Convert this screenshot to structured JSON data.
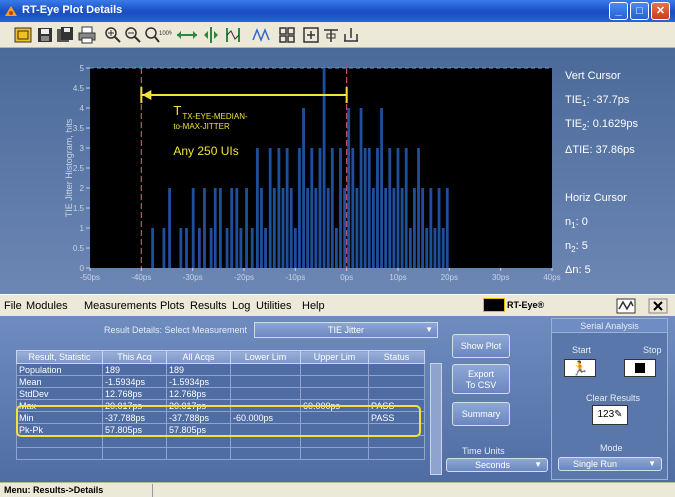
{
  "window": {
    "title": "RT-Eye Plot Details"
  },
  "toolbar": {
    "icons": [
      "zoom-box-icon",
      "save-icon",
      "save-all-icon",
      "print-icon",
      "zoom-in-icon",
      "zoom-out-icon",
      "zoom-100-icon",
      "cursor-horizontal-icon",
      "cursor-vertical-icon",
      "cursor-both-icon",
      "waveform-icon",
      "layout-grid-icon",
      "fit-icon",
      "marker-icon",
      "baseline-icon"
    ]
  },
  "chart_data": {
    "type": "bar",
    "ylabel": "TIE Jitter Histogram, hits",
    "xlim": [
      -50,
      40
    ],
    "ylim": [
      0,
      5
    ],
    "y_ticks": [
      "0",
      "0.5",
      "1",
      "1.5",
      "2",
      "2.5",
      "3",
      "3.5",
      "4",
      "4.5",
      "5"
    ],
    "x_ticks": [
      "-50ps",
      "-40ps",
      "-30ps",
      "-20ps",
      "-10ps",
      "0ps",
      "10ps",
      "20ps",
      "30ps",
      "40ps"
    ],
    "x_tick_values": [
      -50,
      -40,
      -30,
      -20,
      -10,
      0,
      10,
      20,
      30,
      40
    ],
    "bar_color": "#1f4f9c",
    "x_unit": "ps",
    "series": [
      {
        "x": [
          -37.8,
          -35.6,
          -34.5,
          -32.3,
          -31.2,
          -29.9,
          -28.7,
          -27.7,
          -26.4,
          -25.6,
          -24.6,
          -23.3,
          -22.4,
          -21.4,
          -20.6,
          -19.5,
          -18.4,
          -17.4,
          -16.6,
          -15.8,
          -14.9,
          -14.1,
          -13.2,
          -12.4,
          -11.6,
          -10.8,
          -10.0,
          -9.2,
          -8.4,
          -7.6,
          -6.8,
          -6.0,
          -5.2,
          -4.4,
          -3.6,
          -2.8,
          -2.0,
          -1.2,
          -0.4,
          0.4,
          1.2,
          2.0,
          2.8,
          3.6,
          4.4,
          5.2,
          6.0,
          6.8,
          7.6,
          8.4,
          9.2,
          10.0,
          10.8,
          11.6,
          12.4,
          13.2,
          14.0,
          14.8,
          15.6,
          16.4,
          17.2,
          18.0,
          18.8,
          19.6
        ],
        "y": [
          1,
          1,
          2,
          1,
          1,
          2,
          1,
          2,
          1,
          2,
          2,
          1,
          2,
          2,
          1,
          2,
          1,
          3,
          2,
          1,
          3,
          2,
          3,
          2,
          3,
          2,
          1,
          3,
          4,
          2,
          3,
          2,
          3,
          5,
          2,
          3,
          1,
          3,
          2,
          4,
          3,
          2,
          4,
          3,
          3,
          2,
          3,
          4,
          2,
          3,
          2,
          3,
          2,
          3,
          1,
          2,
          3,
          2,
          1,
          2,
          1,
          2,
          1,
          2
        ]
      }
    ],
    "cursor_lines_x": [
      -40,
      0
    ],
    "annotation": {
      "main": "T",
      "sub_line1": "TX-EYE-MEDIAN-",
      "sub_line2": "to-MAX-JITTER",
      "note": "Any 250 UIs",
      "arrow_from": -40,
      "arrow_to": 0
    }
  },
  "cursors": {
    "vert_title": "Vert Cursor",
    "tie1_prefix": "TIE",
    "tie1_sub": "1",
    "tie1_value": ": -37.7ps",
    "tie2_prefix": "TIE",
    "tie2_sub": "2",
    "tie2_value": ": 0.1629ps",
    "dtie": "ΔTIE: 37.86ps",
    "horiz_title": "Horiz Cursor",
    "n1_prefix": "n",
    "n1_sub": "1",
    "n1_value": ": 0",
    "n2_prefix": "n",
    "n2_sub": "2",
    "n2_value": ": 5",
    "dn": "Δn: 5"
  },
  "menu": {
    "items": [
      "File",
      "Modules",
      "Measurements",
      "Plots",
      "Results",
      "Log",
      "Utilities",
      "Help"
    ],
    "logo_text": "RT-Eye®"
  },
  "results": {
    "details_label": "Result Details: Select Measurement",
    "measurement_selected": "TIE Jitter",
    "columns": [
      "Result, Statistic",
      "This Acq",
      "All Acqs",
      "Lower Lim",
      "Upper Lim",
      "Status"
    ],
    "rows": [
      [
        "Population",
        "189",
        "189",
        "",
        "",
        ""
      ],
      [
        "Mean",
        "-1.5934ps",
        "-1.5934ps",
        "",
        "",
        ""
      ],
      [
        "StdDev",
        "12.768ps",
        "12.768ps",
        "",
        "",
        ""
      ],
      [
        "Max",
        "20.017ps",
        "20.017ps",
        "",
        "60.000ps",
        "PASS"
      ],
      [
        "Min",
        "-37.788ps",
        "-37.788ps",
        "-60.000ps",
        "",
        "PASS"
      ],
      [
        "Pk-Pk",
        "57.805ps",
        "57.805ps",
        "",
        "",
        ""
      ],
      [
        "",
        "",
        "",
        "",
        "",
        ""
      ],
      [
        "",
        "",
        "",
        "",
        "",
        ""
      ]
    ],
    "show_plot": "Show Plot",
    "export_line1": "Export",
    "export_line2": "To CSV",
    "summary": "Summary",
    "time_units_label": "Time Units",
    "time_units_value": "Seconds"
  },
  "serial": {
    "title": "Serial Analysis",
    "start": "Start",
    "stop": "Stop",
    "clear_results": "Clear Results",
    "mode_label": "Mode",
    "mode_value": "Single Run"
  },
  "status": {
    "text": "Menu: Results->Details"
  }
}
